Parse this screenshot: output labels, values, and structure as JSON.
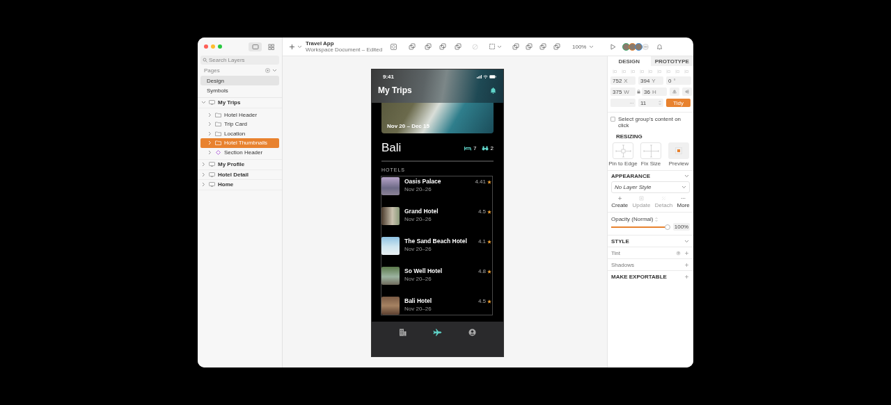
{
  "window": {
    "title": "Travel App",
    "subtitle": "Workspace Document – Edited"
  },
  "sidebar": {
    "view_modes": [
      {
        "kind": "canvas",
        "selected": true
      },
      {
        "kind": "grid",
        "selected": false
      }
    ],
    "search": {
      "placeholder": "Search Layers"
    },
    "pages_label": "Pages",
    "pages": [
      {
        "label": "Design",
        "selected": true
      },
      {
        "label": "Symbols",
        "selected": false
      }
    ],
    "layers": [
      {
        "label": "My Trips",
        "kind": "artboard",
        "expanded": true,
        "selected": false,
        "children": [
          {
            "label": "Hotel Header",
            "kind": "folder",
            "expanded": false,
            "selected": false
          },
          {
            "label": "Trip Card",
            "kind": "folder",
            "expanded": false,
            "selected": false
          },
          {
            "label": "Location",
            "kind": "folder",
            "expanded": false,
            "selected": false
          },
          {
            "label": "Hotel Thumbnails",
            "kind": "folder",
            "expanded": false,
            "selected": true
          },
          {
            "label": "Section Header",
            "kind": "symbol",
            "expanded": false,
            "selected": false
          }
        ]
      },
      {
        "label": "My Profile",
        "kind": "artboard",
        "expanded": false,
        "selected": false
      },
      {
        "label": "Hotel Detail",
        "kind": "artboard",
        "expanded": false,
        "selected": false
      },
      {
        "label": "Home",
        "kind": "artboard",
        "expanded": false,
        "selected": false
      }
    ]
  },
  "toolbar": {
    "zoom": "100%",
    "collaborators": [
      {
        "color": "#3daa6e"
      },
      {
        "color": "#e8822f"
      },
      {
        "color": "#3b8fe0"
      }
    ]
  },
  "phone": {
    "time": "9:41",
    "title": "My Trips",
    "trip_dates": "Nov 20 – Dec 15",
    "destination": "Bali",
    "hotel_count": "7",
    "activity_count": "2",
    "section": "HOTELS",
    "hotels": [
      {
        "name": "Oasis Palace",
        "dates": "Nov 20–26",
        "rating": "4.41"
      },
      {
        "name": "Grand Hotel",
        "dates": "Nov 20–26",
        "rating": "4.5"
      },
      {
        "name": "The Sand Beach Hotel",
        "dates": "Nov 20–26",
        "rating": "4.1"
      },
      {
        "name": "So Well Hotel",
        "dates": "Nov 20–26",
        "rating": "4.8"
      },
      {
        "name": "Bali Hotel",
        "dates": "Nov 20–26",
        "rating": "4.5"
      }
    ],
    "tabs": [
      {
        "kind": "hotels",
        "selected": false
      },
      {
        "kind": "trips",
        "selected": true
      },
      {
        "kind": "profile",
        "selected": false
      }
    ]
  },
  "inspector": {
    "tabs": [
      {
        "label": "DESIGN",
        "selected": true
      },
      {
        "label": "PROTOTYPE",
        "selected": false
      }
    ],
    "position": [
      {
        "value": "752",
        "label": "X"
      },
      {
        "value": "394",
        "label": "Y"
      },
      {
        "value": "0",
        "label": "°"
      }
    ],
    "size": [
      {
        "value": "375",
        "label": "W"
      },
      {
        "value": "36",
        "label": "H"
      }
    ],
    "spacing": "11",
    "tidy": "Tidy",
    "select_group": {
      "label": "Select group's content on click",
      "checked": false
    },
    "resizing": {
      "title": "RESIZING",
      "options": [
        {
          "label": "Pin to Edge",
          "selected": false
        },
        {
          "label": "Fix Size",
          "selected": false
        },
        {
          "label": "Preview",
          "selected": true
        }
      ]
    },
    "appearance": {
      "title": "APPEARANCE",
      "style": "No Layer Style",
      "actions": [
        {
          "label": "Create",
          "disabled": false
        },
        {
          "label": "Update",
          "disabled": true
        },
        {
          "label": "Detach",
          "disabled": true
        },
        {
          "label": "More",
          "disabled": false
        }
      ]
    },
    "opacity": {
      "label": "Opacity (Normal)",
      "level": 1,
      "value": "100%"
    },
    "sections": [
      {
        "label": "STYLE",
        "kind": "header"
      },
      {
        "label": "Tint",
        "kind": "help"
      },
      {
        "label": "Shadows",
        "kind": "item"
      },
      {
        "label": "MAKE EXPORTABLE",
        "kind": "exportable"
      }
    ]
  }
}
